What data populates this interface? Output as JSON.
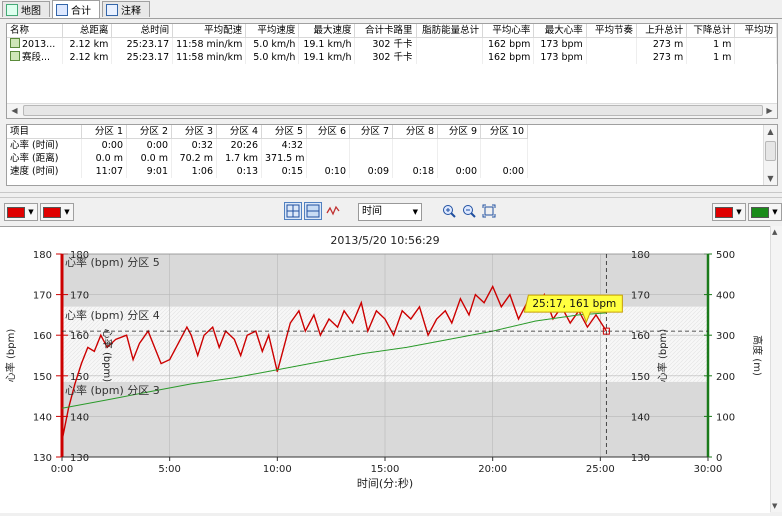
{
  "tabs": [
    {
      "label": "地图",
      "icon": "map-icon"
    },
    {
      "label": "合计",
      "icon": "table-icon"
    },
    {
      "label": "注释",
      "icon": "note-icon"
    }
  ],
  "summary": {
    "columns": [
      "名称",
      "总距离",
      "总时间",
      "平均配速",
      "平均速度",
      "最大速度",
      "合计卡路里",
      "脂肪能量总计",
      "平均心率",
      "最大心率",
      "平均节奏",
      "上升总计",
      "下降总计",
      "平均功"
    ],
    "rows": [
      [
        "2013...",
        "2.12 km",
        "25:23.17",
        "11:58 min/km",
        "5.0 km/h",
        "19.1 km/h",
        "302 千卡",
        "",
        "162 bpm",
        "173 bpm",
        "",
        "273 m",
        "1 m",
        ""
      ],
      [
        "赛段...",
        "2.12 km",
        "25:23.17",
        "11:58 min/km",
        "5.0 km/h",
        "19.1 km/h",
        "302 千卡",
        "",
        "162 bpm",
        "173 bpm",
        "",
        "273 m",
        "1 m",
        ""
      ]
    ]
  },
  "zones": {
    "columns": [
      "项目",
      "分区 1",
      "分区 2",
      "分区 3",
      "分区 4",
      "分区 5",
      "分区 6",
      "分区 7",
      "分区 8",
      "分区 9",
      "分区 10"
    ],
    "rows": [
      [
        "心率 (时间)",
        "0:00",
        "0:00",
        "0:32",
        "20:26",
        "4:32",
        "",
        "",
        "",
        "",
        ""
      ],
      [
        "心率 (距离)",
        "0.0 m",
        "0.0 m",
        "70.2 m",
        "1.7 km",
        "371.5 m",
        "",
        "",
        "",
        "",
        ""
      ],
      [
        "速度 (时间)",
        "11:07",
        "9:01",
        "1:06",
        "0:13",
        "0:15",
        "0:10",
        "0:09",
        "0:18",
        "0:00",
        "0:00"
      ]
    ]
  },
  "toolbar": {
    "left_colors": [
      "#e00000",
      "#e00000"
    ],
    "right_colors": [
      "#e00000",
      "#1a8a1a"
    ],
    "x_axis_select": "时间"
  },
  "chart_data": {
    "type": "line",
    "title": "2013/5/20 10:56:29",
    "xlabel": "时间(分:秒)",
    "ylabel_left": "心率 (bpm)",
    "ylabel_right_inner": "心率 (bpm)",
    "ylabel_right": "高度 (m)",
    "ylabel_left_inner": "心率 (bpm)",
    "xlim": [
      0,
      30
    ],
    "ylim_left": [
      130,
      180
    ],
    "ylim_right": [
      0,
      500
    ],
    "x_ticks": [
      "0:00",
      "5:00",
      "10:00",
      "15:00",
      "20:00",
      "25:00",
      "30:00"
    ],
    "y_ticks_left": [
      130,
      140,
      150,
      160,
      170,
      180
    ],
    "y_ticks_right": [
      0,
      100,
      200,
      300,
      400,
      500
    ],
    "zones": [
      {
        "label": "心率 (bpm) 分区 5",
        "from": 167,
        "to": 180,
        "fill": "#d9d9d9"
      },
      {
        "label": "心率 (bpm) 分区 4",
        "from": 148.5,
        "to": 167,
        "fill": "#f4f4f4"
      },
      {
        "label": "心率 (bpm) 分区 3",
        "from": 130,
        "to": 148.5,
        "fill": "#d9d9d9"
      }
    ],
    "cursor": {
      "x": 25.28,
      "y": 161,
      "label": "25:17, 161 bpm"
    },
    "series": [
      {
        "name": "心率",
        "axis": "left",
        "color": "#cc0000",
        "x": [
          0,
          0.3,
          0.6,
          0.9,
          1.2,
          1.5,
          1.8,
          2.1,
          2.5,
          3.0,
          3.3,
          3.6,
          4.0,
          4.3,
          4.6,
          5.0,
          5.4,
          5.8,
          6.0,
          6.3,
          6.6,
          7.0,
          7.3,
          7.6,
          8.0,
          8.3,
          8.6,
          9.0,
          9.3,
          9.6,
          10.0,
          10.3,
          10.6,
          11.0,
          11.3,
          11.7,
          12.0,
          12.4,
          12.8,
          13.1,
          13.5,
          13.9,
          14.2,
          14.6,
          15.0,
          15.4,
          15.8,
          16.2,
          16.6,
          17.0,
          17.4,
          17.8,
          18.1,
          18.5,
          18.9,
          19.2,
          19.6,
          20.0,
          20.4,
          20.8,
          21.2,
          21.6,
          22.0,
          22.4,
          22.8,
          23.2,
          23.6,
          24.0,
          24.4,
          24.8,
          25.28
        ],
        "y": [
          134,
          142,
          148,
          153,
          157,
          156,
          160,
          157,
          159,
          160,
          154,
          158,
          161,
          157,
          153,
          154,
          158,
          162,
          160,
          155,
          160,
          162,
          157,
          161,
          159,
          155,
          160,
          161,
          156,
          160,
          151,
          157,
          163,
          166,
          161,
          165,
          160,
          164,
          162,
          166,
          163,
          168,
          161,
          166,
          164,
          160,
          166,
          164,
          167,
          160,
          164,
          166,
          163,
          169,
          165,
          170,
          168,
          172,
          167,
          170,
          164,
          168,
          166,
          170,
          164,
          167,
          163,
          166,
          162,
          165,
          161
        ]
      },
      {
        "name": "高度",
        "axis": "right",
        "color": "#2a9a2a",
        "x": [
          0,
          2,
          4,
          6,
          8,
          10,
          12,
          14,
          16,
          18,
          20,
          22,
          24,
          25.28
        ],
        "y": [
          120,
          140,
          160,
          180,
          195,
          215,
          235,
          255,
          270,
          290,
          310,
          335,
          350,
          355
        ]
      }
    ]
  }
}
